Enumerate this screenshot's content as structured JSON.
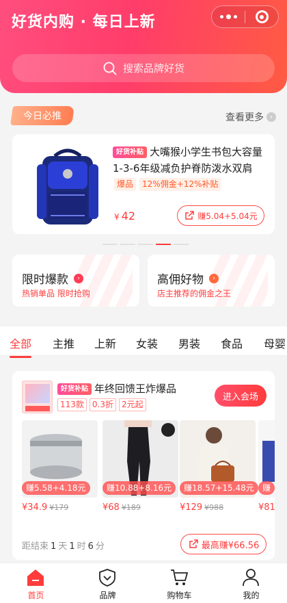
{
  "header": {
    "title": "好货内购 · 每日上新",
    "search_placeholder": "搜索品牌好货"
  },
  "featured": {
    "section_label": "今日必推",
    "see_more": "查看更多",
    "product": {
      "tag": "好货补贴",
      "name": "大嘴猴小学生书包大容量1-3-6年级减负护脊防泼水双肩",
      "badge_hot": "爆品",
      "badge_commission": "12%佣金+12%补贴",
      "currency": "¥",
      "price": "42",
      "earn_label": "赚5.04+5.04元"
    },
    "carousel_total": 5,
    "carousel_active": 3
  },
  "promos": [
    {
      "title": "限时爆款",
      "subtitle": "热销单品 限时抢购"
    },
    {
      "title": "高佣好物",
      "subtitle": "店主推荐的佣金之王"
    }
  ],
  "tabs": [
    "全部",
    "主推",
    "上新",
    "女装",
    "男装",
    "食品",
    "母婴"
  ],
  "event": {
    "thumb_tag": "好货补贴",
    "title": "年终回馈王炸爆品",
    "tags": [
      "113款",
      "0.3折",
      "2元起"
    ],
    "enter_label": "进入会场",
    "items": [
      {
        "earn": "赚5.58+4.18元",
        "price": "¥34.9",
        "original": "¥179"
      },
      {
        "earn": "赚10.88+8.16元",
        "price": "¥68",
        "original": "¥189"
      },
      {
        "earn": "赚18.57+15.48元",
        "price": "¥129",
        "original": "¥988"
      },
      {
        "earn": "赚",
        "price": "¥81",
        "original": ""
      }
    ],
    "countdown_prefix": "距结束",
    "countdown_days": "1",
    "countdown_days_unit": "天",
    "countdown_hours": "1",
    "countdown_hours_unit": "时",
    "countdown_minutes": "6",
    "countdown_minutes_unit": "分",
    "max_earn_label": "最高赚¥66.56"
  },
  "nav": [
    {
      "label": "首页",
      "icon": "home-icon",
      "active": true
    },
    {
      "label": "品牌",
      "icon": "brand-shield-icon",
      "active": false
    },
    {
      "label": "购物车",
      "icon": "cart-icon",
      "active": false
    },
    {
      "label": "我的",
      "icon": "user-icon",
      "active": false
    }
  ],
  "colors": {
    "accent": "#ff3c3c",
    "header_start": "#ff4e7e",
    "header_end": "#ff5b43"
  }
}
